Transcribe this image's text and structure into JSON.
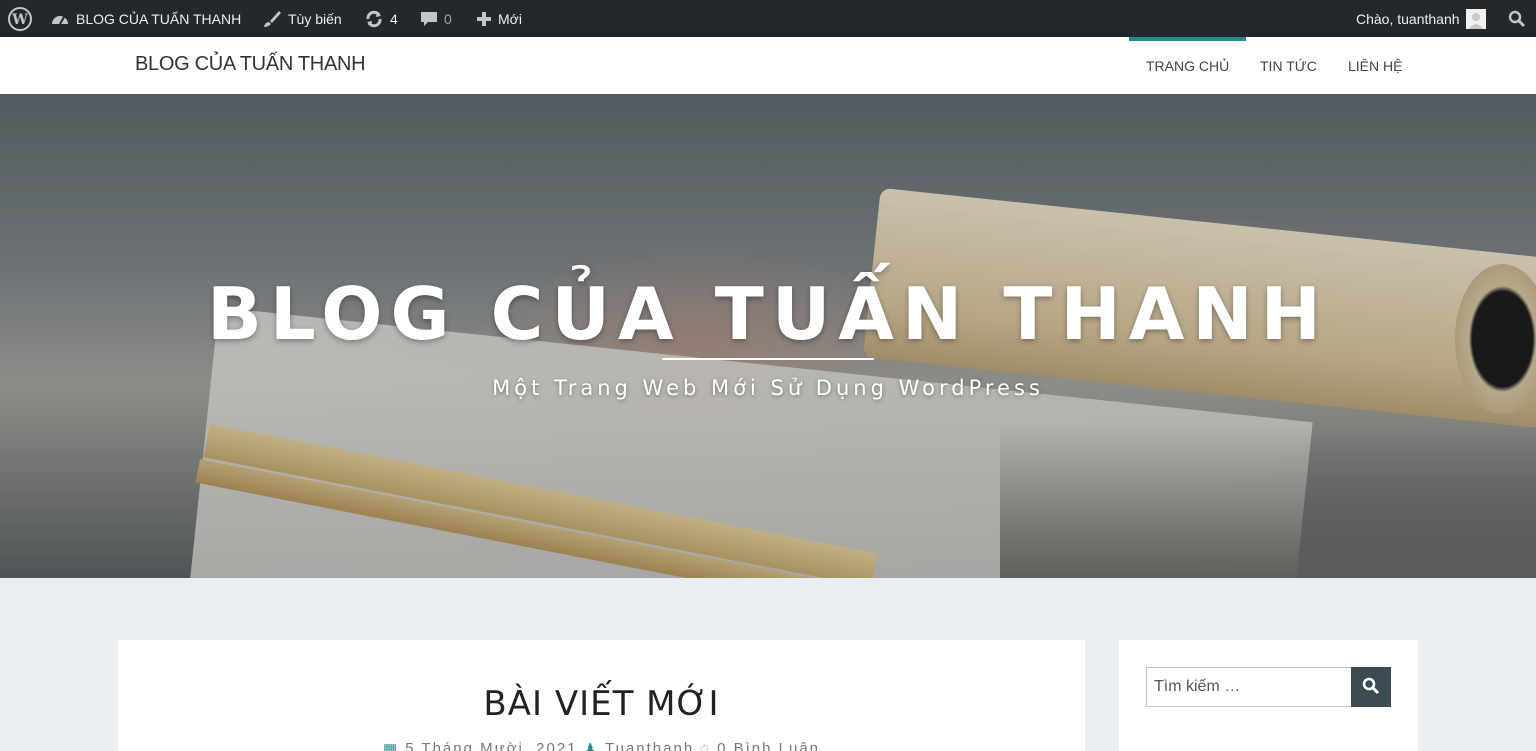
{
  "adminbar": {
    "site_name": "BLOG CỦA TUẤN THANH",
    "customize": "Tùy biến",
    "updates_count": "4",
    "comments_count": "0",
    "new_label": "Mới",
    "greeting": "Chào, tuanthanh"
  },
  "header": {
    "site_title": "BLOG CỦA TUẤN THANH",
    "nav": [
      "TRANG CHỦ",
      "TIN TỨC",
      "LIÊN HỆ"
    ]
  },
  "hero": {
    "title": "BLOG CỦA TUẤN THANH",
    "tagline": "Một Trang Web Mới Sử Dụng WordPress"
  },
  "post": {
    "title": "BÀI VIẾT MỚI",
    "date": "5 Tháng Mười, 2021",
    "author": "Tuanthanh",
    "comments": "0 Bình Luận"
  },
  "sidebar": {
    "search_placeholder": "Tìm kiếm …"
  },
  "colors": {
    "accent": "#1e8c87",
    "adminbar": "#23282d",
    "page_bg": "#e9eef2"
  }
}
